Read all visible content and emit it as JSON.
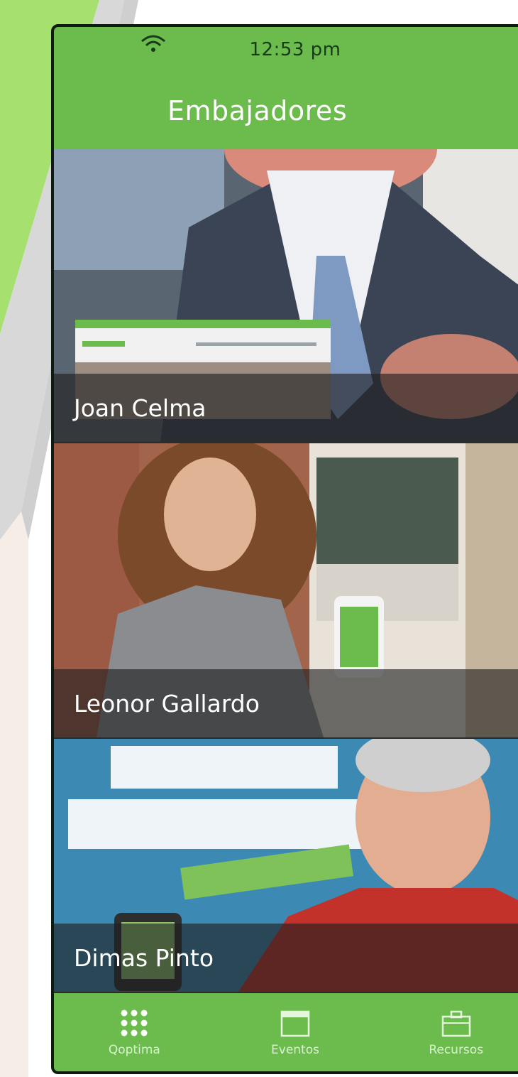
{
  "status_bar": {
    "time": "12:53 pm",
    "wifi_icon": "wifi-icon"
  },
  "header": {
    "title": "Embajadores"
  },
  "ambassadors": [
    {
      "name": "Joan Celma"
    },
    {
      "name": "Leonor Gallardo"
    },
    {
      "name": "Dimas Pinto"
    }
  ],
  "tab_bar": {
    "tabs": [
      {
        "label": "Qoptima",
        "icon": "grid-icon"
      },
      {
        "label": "Eventos",
        "icon": "calendar-icon"
      },
      {
        "label": "Recursos",
        "icon": "briefcase-icon"
      }
    ]
  },
  "colors": {
    "brand_green": "#6bbb4d",
    "accent_green": "#a6e06f",
    "frame_dark": "#0f1a10"
  }
}
